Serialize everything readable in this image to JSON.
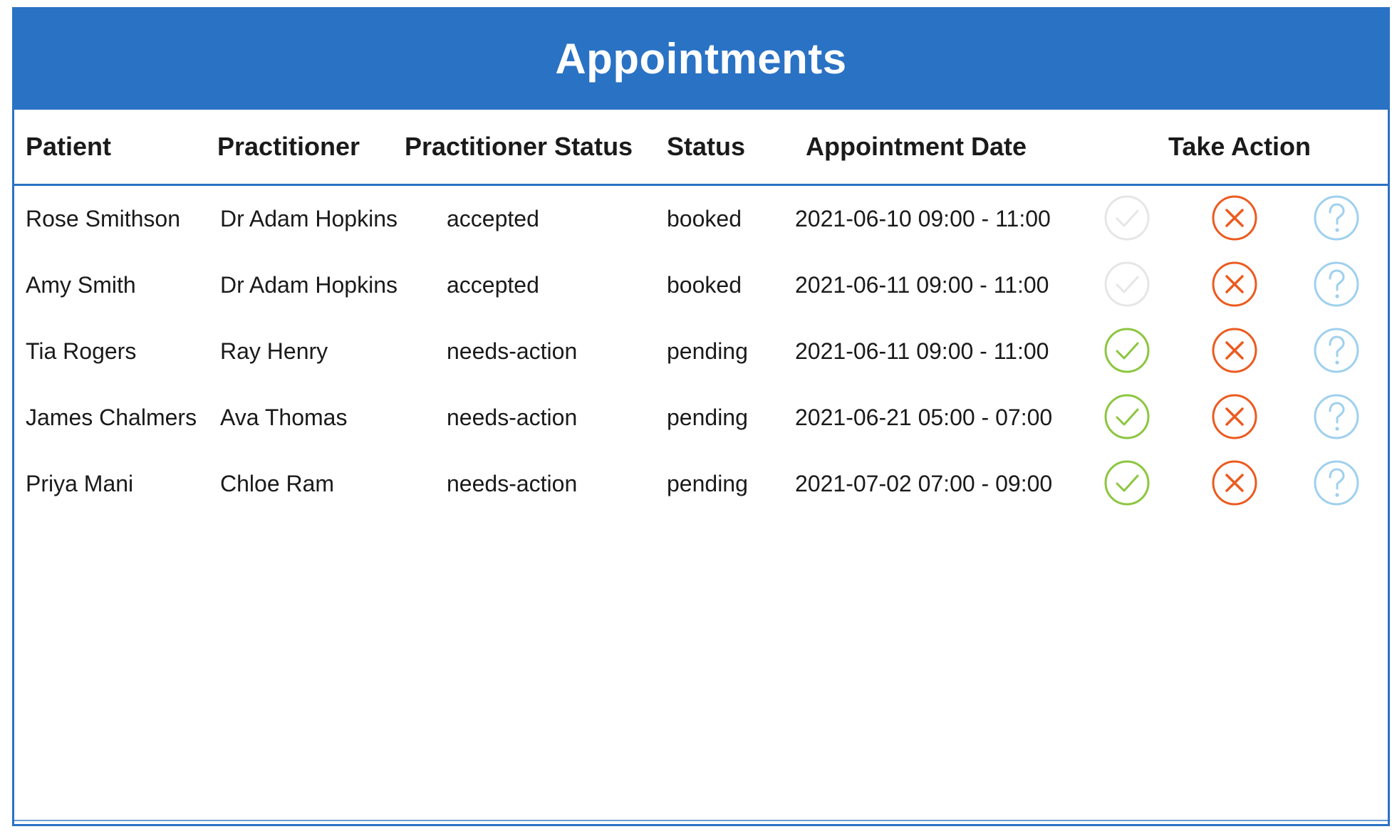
{
  "title": "Appointments",
  "columns": {
    "patient": "Patient",
    "practitioner": "Practitioner",
    "practitioner_status": "Practitioner Status",
    "status": "Status",
    "appointment_date": "Appointment Date",
    "take_action": "Take Action"
  },
  "colors": {
    "accent": "#2a72c4",
    "accept_enabled": "#8cc63f",
    "accept_disabled": "#e6e6e6",
    "reject": "#ec5a1f",
    "query": "#9fd0ee"
  },
  "icons": {
    "accept": "check-circle-icon",
    "reject": "x-circle-icon",
    "query": "question-circle-icon"
  },
  "rows": [
    {
      "patient": "Rose Smithson",
      "practitioner": "Dr Adam Hopkins",
      "practitioner_status": "accepted",
      "status": "booked",
      "date": "2021-06-10 09:00 - 11:00",
      "accept_enabled": false
    },
    {
      "patient": "Amy Smith",
      "practitioner": "Dr Adam Hopkins",
      "practitioner_status": "accepted",
      "status": "booked",
      "date": "2021-06-11 09:00 - 11:00",
      "accept_enabled": false
    },
    {
      "patient": "Tia Rogers",
      "practitioner": "Ray Henry",
      "practitioner_status": "needs-action",
      "status": "pending",
      "date": "2021-06-11 09:00 - 11:00",
      "accept_enabled": true
    },
    {
      "patient": "James Chalmers",
      "practitioner": "Ava Thomas",
      "practitioner_status": "needs-action",
      "status": "pending",
      "date": "2021-06-21 05:00 - 07:00",
      "accept_enabled": true
    },
    {
      "patient": "Priya Mani",
      "practitioner": "Chloe Ram",
      "practitioner_status": "needs-action",
      "status": "pending",
      "date": "2021-07-02 07:00 - 09:00",
      "accept_enabled": true
    }
  ]
}
